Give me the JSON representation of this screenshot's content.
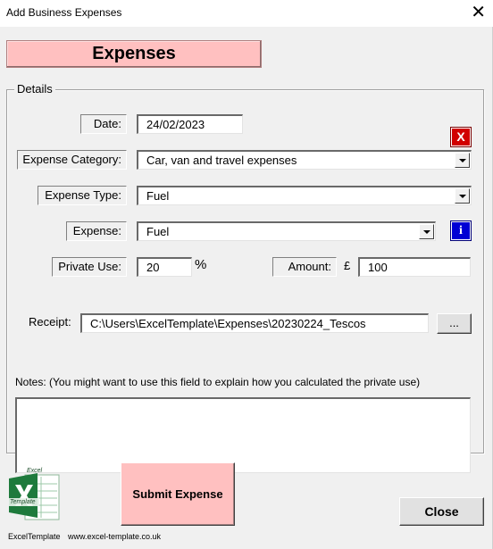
{
  "window": {
    "title": "Add Business Expenses",
    "close_glyph": "✕"
  },
  "header": {
    "title": "Expenses"
  },
  "details": {
    "legend": "Details",
    "clear_button": "X",
    "date": {
      "label": "Date:",
      "value": "24/02/2023"
    },
    "category": {
      "label": "Expense Category:",
      "value": "Car, van and travel expenses"
    },
    "type": {
      "label": "Expense Type:",
      "value": "Fuel"
    },
    "expense": {
      "label": "Expense:",
      "value": "Fuel"
    },
    "info_button": "i",
    "private_use": {
      "label": "Private Use:",
      "value": "20",
      "unit": "%"
    },
    "amount": {
      "label": "Amount:",
      "currency": "£",
      "value": "100"
    },
    "receipt": {
      "label": "Receipt:",
      "value": "C:\\Users\\ExcelTemplate\\Expenses\\20230224_Tescos",
      "browse_label": "..."
    },
    "notes": {
      "label": "Notes: (You might want to use this field to explain how you calculated the private use)",
      "value": ""
    }
  },
  "actions": {
    "submit_label": "Submit Expense",
    "close_label": "Close"
  },
  "footer": {
    "logo_top_text": "Excel",
    "logo_bottom_text": "Template",
    "brand_name": "ExcelTemplate",
    "website": "www.excel-template.co.uk"
  },
  "colors": {
    "accent_pink": "#ffc0c0",
    "clear_red": "#d10000",
    "info_blue": "#0000d4",
    "excel_green": "#1e7a3c"
  },
  "icons": {
    "window_close": "close-icon",
    "dropdown": "chevron-down-icon",
    "logo": "excel-logo-icon"
  }
}
